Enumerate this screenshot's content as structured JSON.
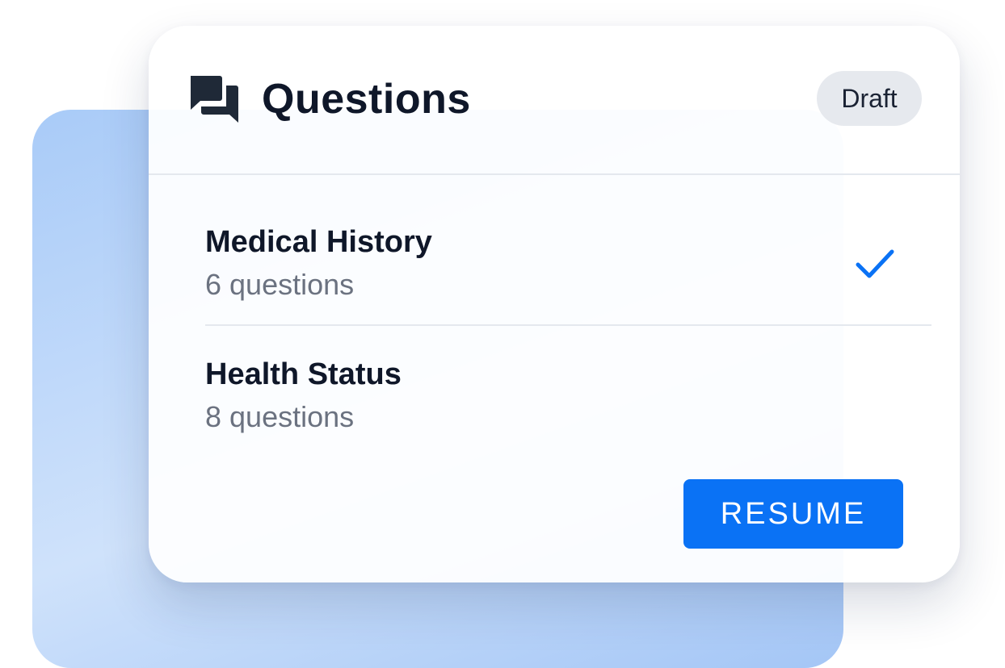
{
  "header": {
    "title": "Questions",
    "icon": "chat-bubbles-icon",
    "status_badge": "Draft"
  },
  "sections": [
    {
      "title": "Medical History",
      "subtitle": "6 questions",
      "completed": true,
      "status_icon": "checkmark-icon"
    },
    {
      "title": "Health Status",
      "subtitle": "8 questions",
      "completed": false
    }
  ],
  "actions": {
    "resume_label": "RESUME"
  },
  "colors": {
    "accent": "#0a72f5",
    "title_text": "#0f1729",
    "muted_text": "#6b7280",
    "badge_bg": "#e6e9ee",
    "backdrop_blue": "#a9cbf8"
  }
}
